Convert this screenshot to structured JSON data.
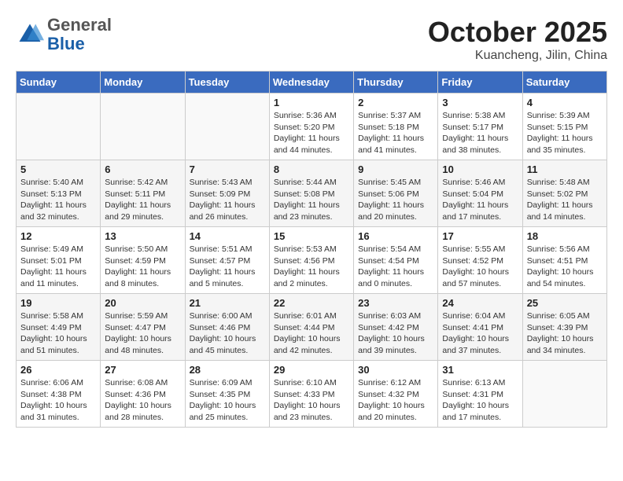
{
  "header": {
    "logo": {
      "general": "General",
      "blue": "Blue"
    },
    "title": "October 2025",
    "location": "Kuancheng, Jilin, China"
  },
  "weekdays": [
    "Sunday",
    "Monday",
    "Tuesday",
    "Wednesday",
    "Thursday",
    "Friday",
    "Saturday"
  ],
  "weeks": [
    [
      {
        "day": null
      },
      {
        "day": null
      },
      {
        "day": null
      },
      {
        "day": 1,
        "sunrise": "5:36 AM",
        "sunset": "5:20 PM",
        "daylight": "11 hours and 44 minutes."
      },
      {
        "day": 2,
        "sunrise": "5:37 AM",
        "sunset": "5:18 PM",
        "daylight": "11 hours and 41 minutes."
      },
      {
        "day": 3,
        "sunrise": "5:38 AM",
        "sunset": "5:17 PM",
        "daylight": "11 hours and 38 minutes."
      },
      {
        "day": 4,
        "sunrise": "5:39 AM",
        "sunset": "5:15 PM",
        "daylight": "11 hours and 35 minutes."
      }
    ],
    [
      {
        "day": 5,
        "sunrise": "5:40 AM",
        "sunset": "5:13 PM",
        "daylight": "11 hours and 32 minutes."
      },
      {
        "day": 6,
        "sunrise": "5:42 AM",
        "sunset": "5:11 PM",
        "daylight": "11 hours and 29 minutes."
      },
      {
        "day": 7,
        "sunrise": "5:43 AM",
        "sunset": "5:09 PM",
        "daylight": "11 hours and 26 minutes."
      },
      {
        "day": 8,
        "sunrise": "5:44 AM",
        "sunset": "5:08 PM",
        "daylight": "11 hours and 23 minutes."
      },
      {
        "day": 9,
        "sunrise": "5:45 AM",
        "sunset": "5:06 PM",
        "daylight": "11 hours and 20 minutes."
      },
      {
        "day": 10,
        "sunrise": "5:46 AM",
        "sunset": "5:04 PM",
        "daylight": "11 hours and 17 minutes."
      },
      {
        "day": 11,
        "sunrise": "5:48 AM",
        "sunset": "5:02 PM",
        "daylight": "11 hours and 14 minutes."
      }
    ],
    [
      {
        "day": 12,
        "sunrise": "5:49 AM",
        "sunset": "5:01 PM",
        "daylight": "11 hours and 11 minutes."
      },
      {
        "day": 13,
        "sunrise": "5:50 AM",
        "sunset": "4:59 PM",
        "daylight": "11 hours and 8 minutes."
      },
      {
        "day": 14,
        "sunrise": "5:51 AM",
        "sunset": "4:57 PM",
        "daylight": "11 hours and 5 minutes."
      },
      {
        "day": 15,
        "sunrise": "5:53 AM",
        "sunset": "4:56 PM",
        "daylight": "11 hours and 2 minutes."
      },
      {
        "day": 16,
        "sunrise": "5:54 AM",
        "sunset": "4:54 PM",
        "daylight": "11 hours and 0 minutes."
      },
      {
        "day": 17,
        "sunrise": "5:55 AM",
        "sunset": "4:52 PM",
        "daylight": "10 hours and 57 minutes."
      },
      {
        "day": 18,
        "sunrise": "5:56 AM",
        "sunset": "4:51 PM",
        "daylight": "10 hours and 54 minutes."
      }
    ],
    [
      {
        "day": 19,
        "sunrise": "5:58 AM",
        "sunset": "4:49 PM",
        "daylight": "10 hours and 51 minutes."
      },
      {
        "day": 20,
        "sunrise": "5:59 AM",
        "sunset": "4:47 PM",
        "daylight": "10 hours and 48 minutes."
      },
      {
        "day": 21,
        "sunrise": "6:00 AM",
        "sunset": "4:46 PM",
        "daylight": "10 hours and 45 minutes."
      },
      {
        "day": 22,
        "sunrise": "6:01 AM",
        "sunset": "4:44 PM",
        "daylight": "10 hours and 42 minutes."
      },
      {
        "day": 23,
        "sunrise": "6:03 AM",
        "sunset": "4:42 PM",
        "daylight": "10 hours and 39 minutes."
      },
      {
        "day": 24,
        "sunrise": "6:04 AM",
        "sunset": "4:41 PM",
        "daylight": "10 hours and 37 minutes."
      },
      {
        "day": 25,
        "sunrise": "6:05 AM",
        "sunset": "4:39 PM",
        "daylight": "10 hours and 34 minutes."
      }
    ],
    [
      {
        "day": 26,
        "sunrise": "6:06 AM",
        "sunset": "4:38 PM",
        "daylight": "10 hours and 31 minutes."
      },
      {
        "day": 27,
        "sunrise": "6:08 AM",
        "sunset": "4:36 PM",
        "daylight": "10 hours and 28 minutes."
      },
      {
        "day": 28,
        "sunrise": "6:09 AM",
        "sunset": "4:35 PM",
        "daylight": "10 hours and 25 minutes."
      },
      {
        "day": 29,
        "sunrise": "6:10 AM",
        "sunset": "4:33 PM",
        "daylight": "10 hours and 23 minutes."
      },
      {
        "day": 30,
        "sunrise": "6:12 AM",
        "sunset": "4:32 PM",
        "daylight": "10 hours and 20 minutes."
      },
      {
        "day": 31,
        "sunrise": "6:13 AM",
        "sunset": "4:31 PM",
        "daylight": "10 hours and 17 minutes."
      },
      {
        "day": null
      }
    ]
  ],
  "labels": {
    "sunrise": "Sunrise:",
    "sunset": "Sunset:",
    "daylight": "Daylight:"
  }
}
